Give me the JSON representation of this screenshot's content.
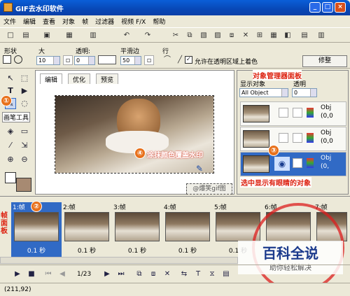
{
  "window": {
    "title": "GIF去水印软件"
  },
  "menu": [
    "文件",
    "编辑",
    "查看",
    "对象",
    "帧",
    "过滤器",
    "视频 F/X",
    "帮助"
  ],
  "props": {
    "shape_label": "形状",
    "size_label": "大",
    "size_value": "10",
    "opacity_label": "透明:",
    "opacity_value": "0",
    "smooth_label": "平滑边",
    "smooth_value": "50",
    "row_label": "行",
    "allow_checkbox": "允许在透明区域上着色",
    "modify_button": "修整"
  },
  "tools": {
    "brush_label": "画笔工具"
  },
  "canvas": {
    "tabs": [
      "编辑",
      "优化",
      "预览"
    ]
  },
  "annotations": {
    "a1": "①",
    "a2": "②",
    "a3": "③",
    "a4_num": "④",
    "a4_text": "涂抹颜色覆盖水印",
    "a3_text": "选中显示有眼睛的对象",
    "watermark": "@爆笑gif图",
    "frame_panel_label": "帧面板"
  },
  "objpanel": {
    "title": "对象管理器面板",
    "show_label": "显示对象",
    "opacity_label": "透明",
    "filter_value": "All Object",
    "opacity_value": "0",
    "objects": [
      {
        "name": "Obj",
        "pos": "(0,0"
      },
      {
        "name": "Obj",
        "pos": "(0,0"
      },
      {
        "name": "Obj",
        "pos": "(0,"
      }
    ]
  },
  "frames": [
    {
      "label": "1:帧",
      "delay": "0.1 秒"
    },
    {
      "label": "2:帧",
      "delay": "0.1 秒"
    },
    {
      "label": "3:帧",
      "delay": "0.1 秒"
    },
    {
      "label": "4:帧",
      "delay": "0.1 秒"
    },
    {
      "label": "5:帧",
      "delay": "0.1 秒"
    },
    {
      "label": "6:帧",
      "delay": ""
    },
    {
      "label": "7:帧",
      "delay": ""
    }
  ],
  "playback": {
    "frame_counter": "1/23"
  },
  "status": {
    "coords": "(211,92)"
  },
  "brand": {
    "name": "百科全说",
    "slogan": "助你轻松解决"
  },
  "colors": {
    "title_bar": "#0a5fd8",
    "selection": "#316ac5",
    "annotation": "#dd2211",
    "seal": "#dc1e1e"
  }
}
